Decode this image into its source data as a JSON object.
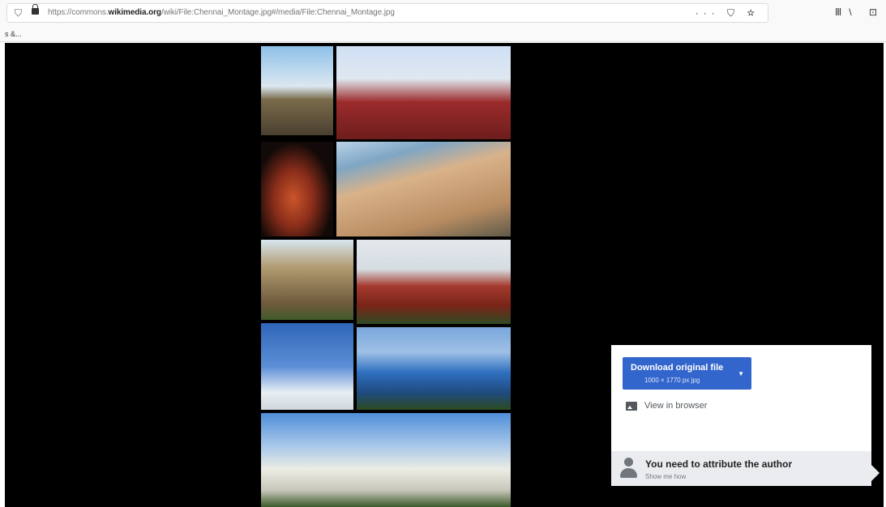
{
  "browser": {
    "url_prefix": "https://commons.",
    "url_domain": "wikimedia.org",
    "url_path": "/wiki/File:Chennai_Montage.jpg#/media/File:Chennai_Montage.jpg",
    "page_actions": "··· ⛉ ☆",
    "toolbar_icons": "Ⅲ\\ ⊡ ⊖",
    "bookmark_text": "s &..."
  },
  "viewer": {
    "image_alt": "Chennai Montage",
    "tiles": [
      "valluvar-kottam-photo",
      "chennai-central-photo",
      "bharatanatyam-dancer-photo",
      "marina-beach-photo",
      "kapaleeshwarar-temple-photo",
      "madras-high-court-photo",
      "santhome-church-photo",
      "tidel-park-building-photo",
      "ripon-building-photo"
    ]
  },
  "download_panel": {
    "download_label": "Download original file",
    "download_sublabel": "1000 × 1770 px jpg",
    "view_in_browser": "View in browser",
    "attribution_title": "You need to attribute the author",
    "attribution_link": "Show me how"
  },
  "colors": {
    "accent": "#3366cc",
    "panel_footer": "#eaecf0",
    "viewer_bg": "#000000"
  }
}
